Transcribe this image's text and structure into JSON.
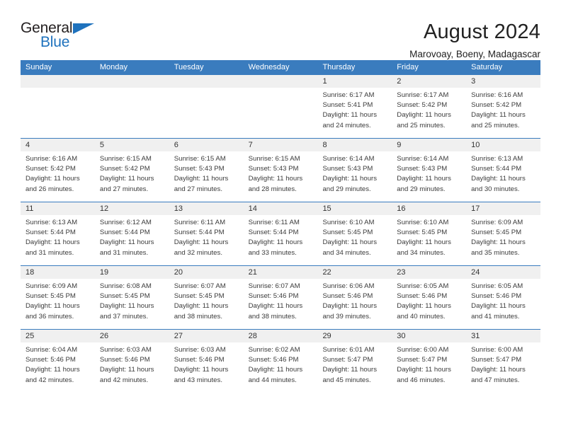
{
  "brand": {
    "name_general": "General",
    "name_blue": "Blue",
    "accent_color": "#1f72bd"
  },
  "header": {
    "title": "August 2024",
    "subtitle": "Marovoay, Boeny, Madagascar"
  },
  "calendar": {
    "header_bg": "#3a7cbe",
    "daynum_bg": "#f0f0f0",
    "weekday_labels": [
      "Sunday",
      "Monday",
      "Tuesday",
      "Wednesday",
      "Thursday",
      "Friday",
      "Saturday"
    ],
    "weeks": [
      [
        {
          "day": "",
          "sunrise": "",
          "sunset": "",
          "daylight_line1": "",
          "daylight_line2": ""
        },
        {
          "day": "",
          "sunrise": "",
          "sunset": "",
          "daylight_line1": "",
          "daylight_line2": ""
        },
        {
          "day": "",
          "sunrise": "",
          "sunset": "",
          "daylight_line1": "",
          "daylight_line2": ""
        },
        {
          "day": "",
          "sunrise": "",
          "sunset": "",
          "daylight_line1": "",
          "daylight_line2": ""
        },
        {
          "day": "1",
          "sunrise": "Sunrise: 6:17 AM",
          "sunset": "Sunset: 5:41 PM",
          "daylight_line1": "Daylight: 11 hours",
          "daylight_line2": "and 24 minutes."
        },
        {
          "day": "2",
          "sunrise": "Sunrise: 6:17 AM",
          "sunset": "Sunset: 5:42 PM",
          "daylight_line1": "Daylight: 11 hours",
          "daylight_line2": "and 25 minutes."
        },
        {
          "day": "3",
          "sunrise": "Sunrise: 6:16 AM",
          "sunset": "Sunset: 5:42 PM",
          "daylight_line1": "Daylight: 11 hours",
          "daylight_line2": "and 25 minutes."
        }
      ],
      [
        {
          "day": "4",
          "sunrise": "Sunrise: 6:16 AM",
          "sunset": "Sunset: 5:42 PM",
          "daylight_line1": "Daylight: 11 hours",
          "daylight_line2": "and 26 minutes."
        },
        {
          "day": "5",
          "sunrise": "Sunrise: 6:15 AM",
          "sunset": "Sunset: 5:42 PM",
          "daylight_line1": "Daylight: 11 hours",
          "daylight_line2": "and 27 minutes."
        },
        {
          "day": "6",
          "sunrise": "Sunrise: 6:15 AM",
          "sunset": "Sunset: 5:43 PM",
          "daylight_line1": "Daylight: 11 hours",
          "daylight_line2": "and 27 minutes."
        },
        {
          "day": "7",
          "sunrise": "Sunrise: 6:15 AM",
          "sunset": "Sunset: 5:43 PM",
          "daylight_line1": "Daylight: 11 hours",
          "daylight_line2": "and 28 minutes."
        },
        {
          "day": "8",
          "sunrise": "Sunrise: 6:14 AM",
          "sunset": "Sunset: 5:43 PM",
          "daylight_line1": "Daylight: 11 hours",
          "daylight_line2": "and 29 minutes."
        },
        {
          "day": "9",
          "sunrise": "Sunrise: 6:14 AM",
          "sunset": "Sunset: 5:43 PM",
          "daylight_line1": "Daylight: 11 hours",
          "daylight_line2": "and 29 minutes."
        },
        {
          "day": "10",
          "sunrise": "Sunrise: 6:13 AM",
          "sunset": "Sunset: 5:44 PM",
          "daylight_line1": "Daylight: 11 hours",
          "daylight_line2": "and 30 minutes."
        }
      ],
      [
        {
          "day": "11",
          "sunrise": "Sunrise: 6:13 AM",
          "sunset": "Sunset: 5:44 PM",
          "daylight_line1": "Daylight: 11 hours",
          "daylight_line2": "and 31 minutes."
        },
        {
          "day": "12",
          "sunrise": "Sunrise: 6:12 AM",
          "sunset": "Sunset: 5:44 PM",
          "daylight_line1": "Daylight: 11 hours",
          "daylight_line2": "and 31 minutes."
        },
        {
          "day": "13",
          "sunrise": "Sunrise: 6:11 AM",
          "sunset": "Sunset: 5:44 PM",
          "daylight_line1": "Daylight: 11 hours",
          "daylight_line2": "and 32 minutes."
        },
        {
          "day": "14",
          "sunrise": "Sunrise: 6:11 AM",
          "sunset": "Sunset: 5:44 PM",
          "daylight_line1": "Daylight: 11 hours",
          "daylight_line2": "and 33 minutes."
        },
        {
          "day": "15",
          "sunrise": "Sunrise: 6:10 AM",
          "sunset": "Sunset: 5:45 PM",
          "daylight_line1": "Daylight: 11 hours",
          "daylight_line2": "and 34 minutes."
        },
        {
          "day": "16",
          "sunrise": "Sunrise: 6:10 AM",
          "sunset": "Sunset: 5:45 PM",
          "daylight_line1": "Daylight: 11 hours",
          "daylight_line2": "and 34 minutes."
        },
        {
          "day": "17",
          "sunrise": "Sunrise: 6:09 AM",
          "sunset": "Sunset: 5:45 PM",
          "daylight_line1": "Daylight: 11 hours",
          "daylight_line2": "and 35 minutes."
        }
      ],
      [
        {
          "day": "18",
          "sunrise": "Sunrise: 6:09 AM",
          "sunset": "Sunset: 5:45 PM",
          "daylight_line1": "Daylight: 11 hours",
          "daylight_line2": "and 36 minutes."
        },
        {
          "day": "19",
          "sunrise": "Sunrise: 6:08 AM",
          "sunset": "Sunset: 5:45 PM",
          "daylight_line1": "Daylight: 11 hours",
          "daylight_line2": "and 37 minutes."
        },
        {
          "day": "20",
          "sunrise": "Sunrise: 6:07 AM",
          "sunset": "Sunset: 5:45 PM",
          "daylight_line1": "Daylight: 11 hours",
          "daylight_line2": "and 38 minutes."
        },
        {
          "day": "21",
          "sunrise": "Sunrise: 6:07 AM",
          "sunset": "Sunset: 5:46 PM",
          "daylight_line1": "Daylight: 11 hours",
          "daylight_line2": "and 38 minutes."
        },
        {
          "day": "22",
          "sunrise": "Sunrise: 6:06 AM",
          "sunset": "Sunset: 5:46 PM",
          "daylight_line1": "Daylight: 11 hours",
          "daylight_line2": "and 39 minutes."
        },
        {
          "day": "23",
          "sunrise": "Sunrise: 6:05 AM",
          "sunset": "Sunset: 5:46 PM",
          "daylight_line1": "Daylight: 11 hours",
          "daylight_line2": "and 40 minutes."
        },
        {
          "day": "24",
          "sunrise": "Sunrise: 6:05 AM",
          "sunset": "Sunset: 5:46 PM",
          "daylight_line1": "Daylight: 11 hours",
          "daylight_line2": "and 41 minutes."
        }
      ],
      [
        {
          "day": "25",
          "sunrise": "Sunrise: 6:04 AM",
          "sunset": "Sunset: 5:46 PM",
          "daylight_line1": "Daylight: 11 hours",
          "daylight_line2": "and 42 minutes."
        },
        {
          "day": "26",
          "sunrise": "Sunrise: 6:03 AM",
          "sunset": "Sunset: 5:46 PM",
          "daylight_line1": "Daylight: 11 hours",
          "daylight_line2": "and 42 minutes."
        },
        {
          "day": "27",
          "sunrise": "Sunrise: 6:03 AM",
          "sunset": "Sunset: 5:46 PM",
          "daylight_line1": "Daylight: 11 hours",
          "daylight_line2": "and 43 minutes."
        },
        {
          "day": "28",
          "sunrise": "Sunrise: 6:02 AM",
          "sunset": "Sunset: 5:46 PM",
          "daylight_line1": "Daylight: 11 hours",
          "daylight_line2": "and 44 minutes."
        },
        {
          "day": "29",
          "sunrise": "Sunrise: 6:01 AM",
          "sunset": "Sunset: 5:47 PM",
          "daylight_line1": "Daylight: 11 hours",
          "daylight_line2": "and 45 minutes."
        },
        {
          "day": "30",
          "sunrise": "Sunrise: 6:00 AM",
          "sunset": "Sunset: 5:47 PM",
          "daylight_line1": "Daylight: 11 hours",
          "daylight_line2": "and 46 minutes."
        },
        {
          "day": "31",
          "sunrise": "Sunrise: 6:00 AM",
          "sunset": "Sunset: 5:47 PM",
          "daylight_line1": "Daylight: 11 hours",
          "daylight_line2": "and 47 minutes."
        }
      ]
    ]
  }
}
